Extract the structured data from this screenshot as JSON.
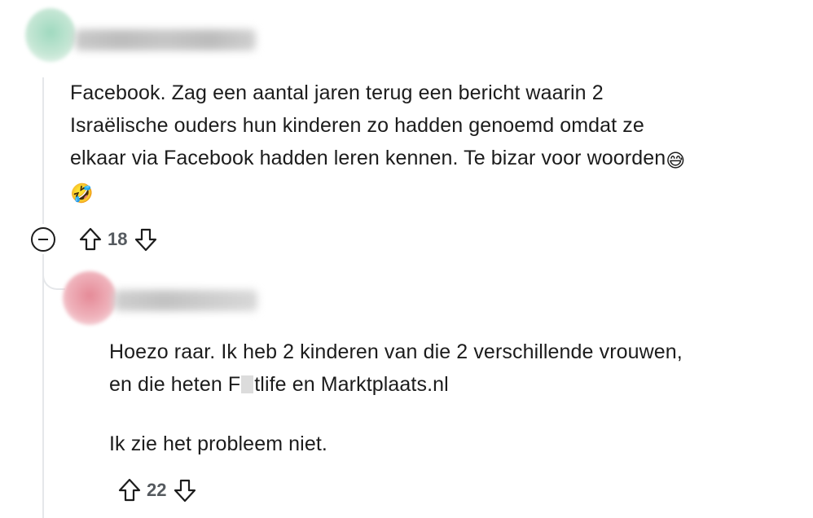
{
  "comments": [
    {
      "text_line1": "Facebook. Zag een aantal jaren terug een bericht waarin 2",
      "text_line2": "Israëlische ouders hun kinderen zo hadden genoemd omdat ze",
      "text_line3": "elkaar via Facebook hadden leren kennen. Te bizar voor woorden",
      "emoji1": "😅",
      "emoji2": "🤣",
      "votes": "18",
      "avatar_color": "#9fd9bf"
    },
    {
      "text_line1": "Hoezo raar. Ik heb 2 kinderen van die 2 verschillende vrouwen,",
      "text_line2_prefix": "en die heten F",
      "text_line2_suffix": "tlife en Marktplaats.nl",
      "text_line3": "Ik zie het probleem niet.",
      "votes": "22",
      "avatar_color": "#e58a97"
    }
  ],
  "icons": {
    "collapse": "collapse-icon",
    "upvote": "upvote-arrow-icon",
    "downvote": "downvote-arrow-icon"
  }
}
